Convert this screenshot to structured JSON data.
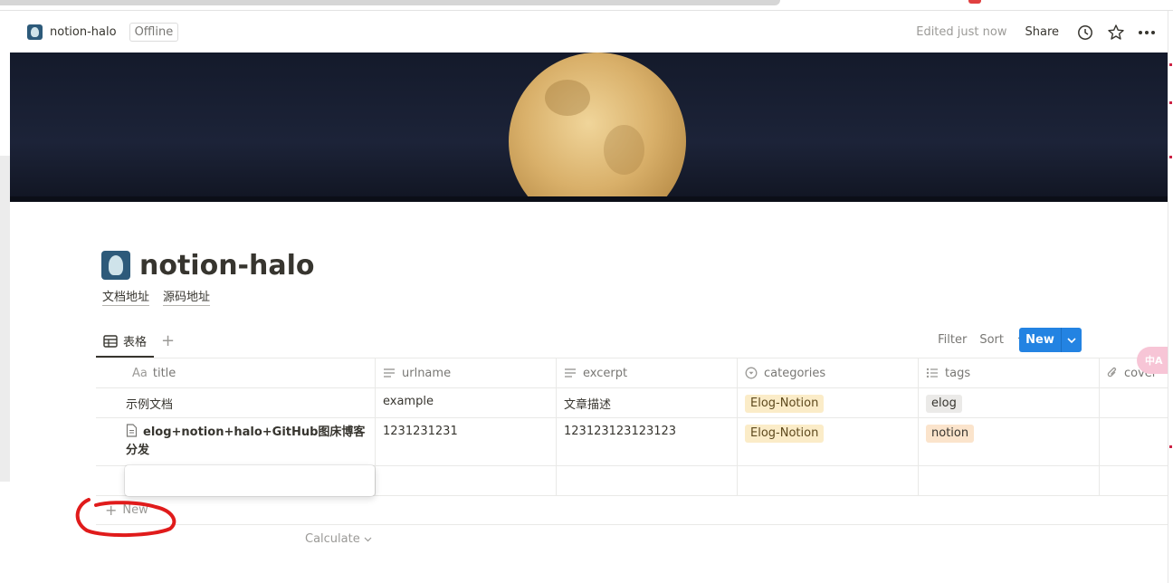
{
  "topbar": {
    "title": "notion-halo",
    "offline": "Offline",
    "edited": "Edited just now",
    "share": "Share",
    "icons": [
      "history-icon",
      "star-icon",
      "more-icon"
    ]
  },
  "page": {
    "title": "notion-halo",
    "links": [
      "文档地址",
      "源码地址"
    ]
  },
  "view": {
    "tab_label": "表格",
    "filter": "Filter",
    "sort": "Sort",
    "new": "New",
    "accent": "#2383e2"
  },
  "table": {
    "columns": [
      "title",
      "urlname",
      "excerpt",
      "categories",
      "tags",
      "cover"
    ],
    "rows": [
      {
        "title": "示例文档",
        "urlname": "example",
        "excerpt": "文章描述",
        "categories": "Elog-Notion",
        "tags": "elog"
      },
      {
        "title": "elog+notion+halo+GitHub图床博客分发",
        "urlname": "1231231231",
        "excerpt": "123123123123123",
        "categories": "Elog-Notion",
        "tags": "notion"
      }
    ],
    "new_row": "New",
    "calculate": "Calculate"
  },
  "translate_badge": "中A"
}
